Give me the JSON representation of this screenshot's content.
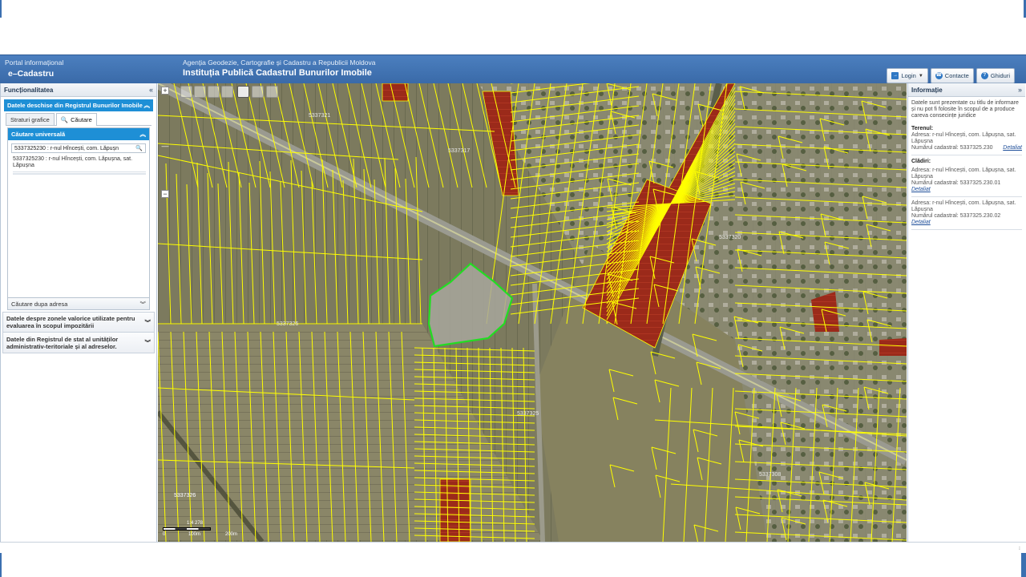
{
  "header": {
    "portal_sub": "Portal informațional",
    "portal_title": "e–Cadastru",
    "agency_sub": "Agenția Geodezie, Cartografie și Cadastru a Republicii Moldova",
    "agency_title": "Instituția Publică Cadastrul Bunurilor Imobile",
    "login_label": "Login",
    "contacts_label": "Contacte",
    "guides_label": "Ghiduri"
  },
  "left_panel": {
    "title": "Funcționalitatea",
    "active_section": "Datele deschise din Registrul Bunurilor Imobile",
    "tabs": [
      "Straturi grafice",
      "Căutare"
    ],
    "search_box": {
      "title": "Căutare universală",
      "input_value": "5337325230 : r-nul Hîncești, com. Lăpușn",
      "result_text": "5337325230 : r-nul Hîncești, com. Lăpușna, sat. Lăpușna"
    },
    "address_search": "Căutare dupa adresa",
    "sections": [
      "Datele despre zonele valorice utilizate pentru evaluarea în scopul impozitării",
      "Datele din Registrul de stat al unităților administrativ-teritoriale și al adreselor."
    ]
  },
  "map": {
    "labels": [
      "5337321",
      "5337317",
      "5337326",
      "5337325",
      "5337320",
      "5337326",
      "5337308",
      "5337326"
    ],
    "scale_labels": [
      "0",
      "100m",
      "200m"
    ],
    "scale_ratio": "1:4 278"
  },
  "right_panel": {
    "title": "Informație",
    "disclaimer": "Datele sunt prezentate cu titlu de informare și nu pot fi folosite în scopul de a produce careva consecințe juridice",
    "land_title": "Terenul:",
    "land_address": "Adresa: r-nul Hîncești, com. Lăpușna, sat. Lăpușna",
    "land_number": "Numărul cadastral: 5337325.230",
    "details_link": "Detaliat",
    "buildings_title": "Clădiri:",
    "building1_address": "Adresa: r-nul Hîncești, com. Lăpușna, sat. Lăpușna",
    "building1_number": "Numărul cadastral: 5337325.230.01",
    "building2_address": "Adresa: r-nul Hîncești, com. Lăpușna, sat. Lăpușna",
    "building2_number": "Numărul cadastral: 5337325.230.02"
  },
  "colors": {
    "header_blue": "#3a6aa8",
    "accordion_blue": "#1e8fd6",
    "parcel_yellow": "#ffff00",
    "selected_green": "#22dd22",
    "red_parcels": "#9b2a1a"
  }
}
